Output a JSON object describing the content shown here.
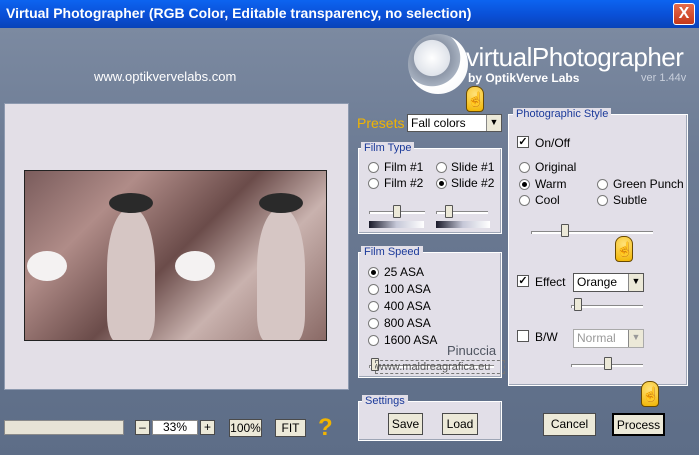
{
  "window": {
    "title": "Virtual Photographer (RGB Color, Editable transparency, no selection)",
    "close_label": "X"
  },
  "header": {
    "website": "www.optikvervelabs.com",
    "logo_text": "virtualPhotographer",
    "logo_by": "by OptikVerve Labs",
    "version": "ver 1.44v"
  },
  "zoom": {
    "minus": "–",
    "value": "33%",
    "plus": "+",
    "full": "100%",
    "fit": "FIT",
    "help": "?"
  },
  "presets": {
    "label": "Presets",
    "selected": "Fall colors"
  },
  "film_type": {
    "title": "Film Type",
    "options": [
      {
        "label": "Film #1",
        "selected": false
      },
      {
        "label": "Slide #1",
        "selected": false
      },
      {
        "label": "Film #2",
        "selected": false
      },
      {
        "label": "Slide #2",
        "selected": true
      }
    ]
  },
  "film_speed": {
    "title": "Film Speed",
    "options": [
      {
        "label": "25 ASA",
        "selected": true
      },
      {
        "label": "100 ASA",
        "selected": false
      },
      {
        "label": "400 ASA",
        "selected": false
      },
      {
        "label": "800 ASA",
        "selected": false
      },
      {
        "label": "1600 ASA",
        "selected": false
      }
    ]
  },
  "settings": {
    "title": "Settings",
    "save": "Save",
    "load": "Load"
  },
  "style": {
    "title": "Photographic Style",
    "onoff": {
      "label": "On/Off",
      "checked": true
    },
    "options": [
      {
        "label": "Original",
        "selected": false
      },
      {
        "label": "Warm",
        "selected": true
      },
      {
        "label": "Green Punch",
        "selected": false
      },
      {
        "label": "Cool",
        "selected": false
      },
      {
        "label": "Subtle",
        "selected": false
      }
    ],
    "effect": {
      "label": "Effect",
      "checked": true,
      "value": "Orange"
    },
    "bw": {
      "label": "B/W",
      "checked": false,
      "value": "Normal"
    }
  },
  "actions": {
    "cancel": "Cancel",
    "process": "Process"
  },
  "watermark": {
    "name": "Pinuccia",
    "url": "www.maldreagrafica.eu"
  },
  "colors": {
    "accent": "#0a4fd6",
    "panel": "#e2dfe8",
    "title_blue": "#1b3a9a",
    "hand": "#f1b400"
  }
}
